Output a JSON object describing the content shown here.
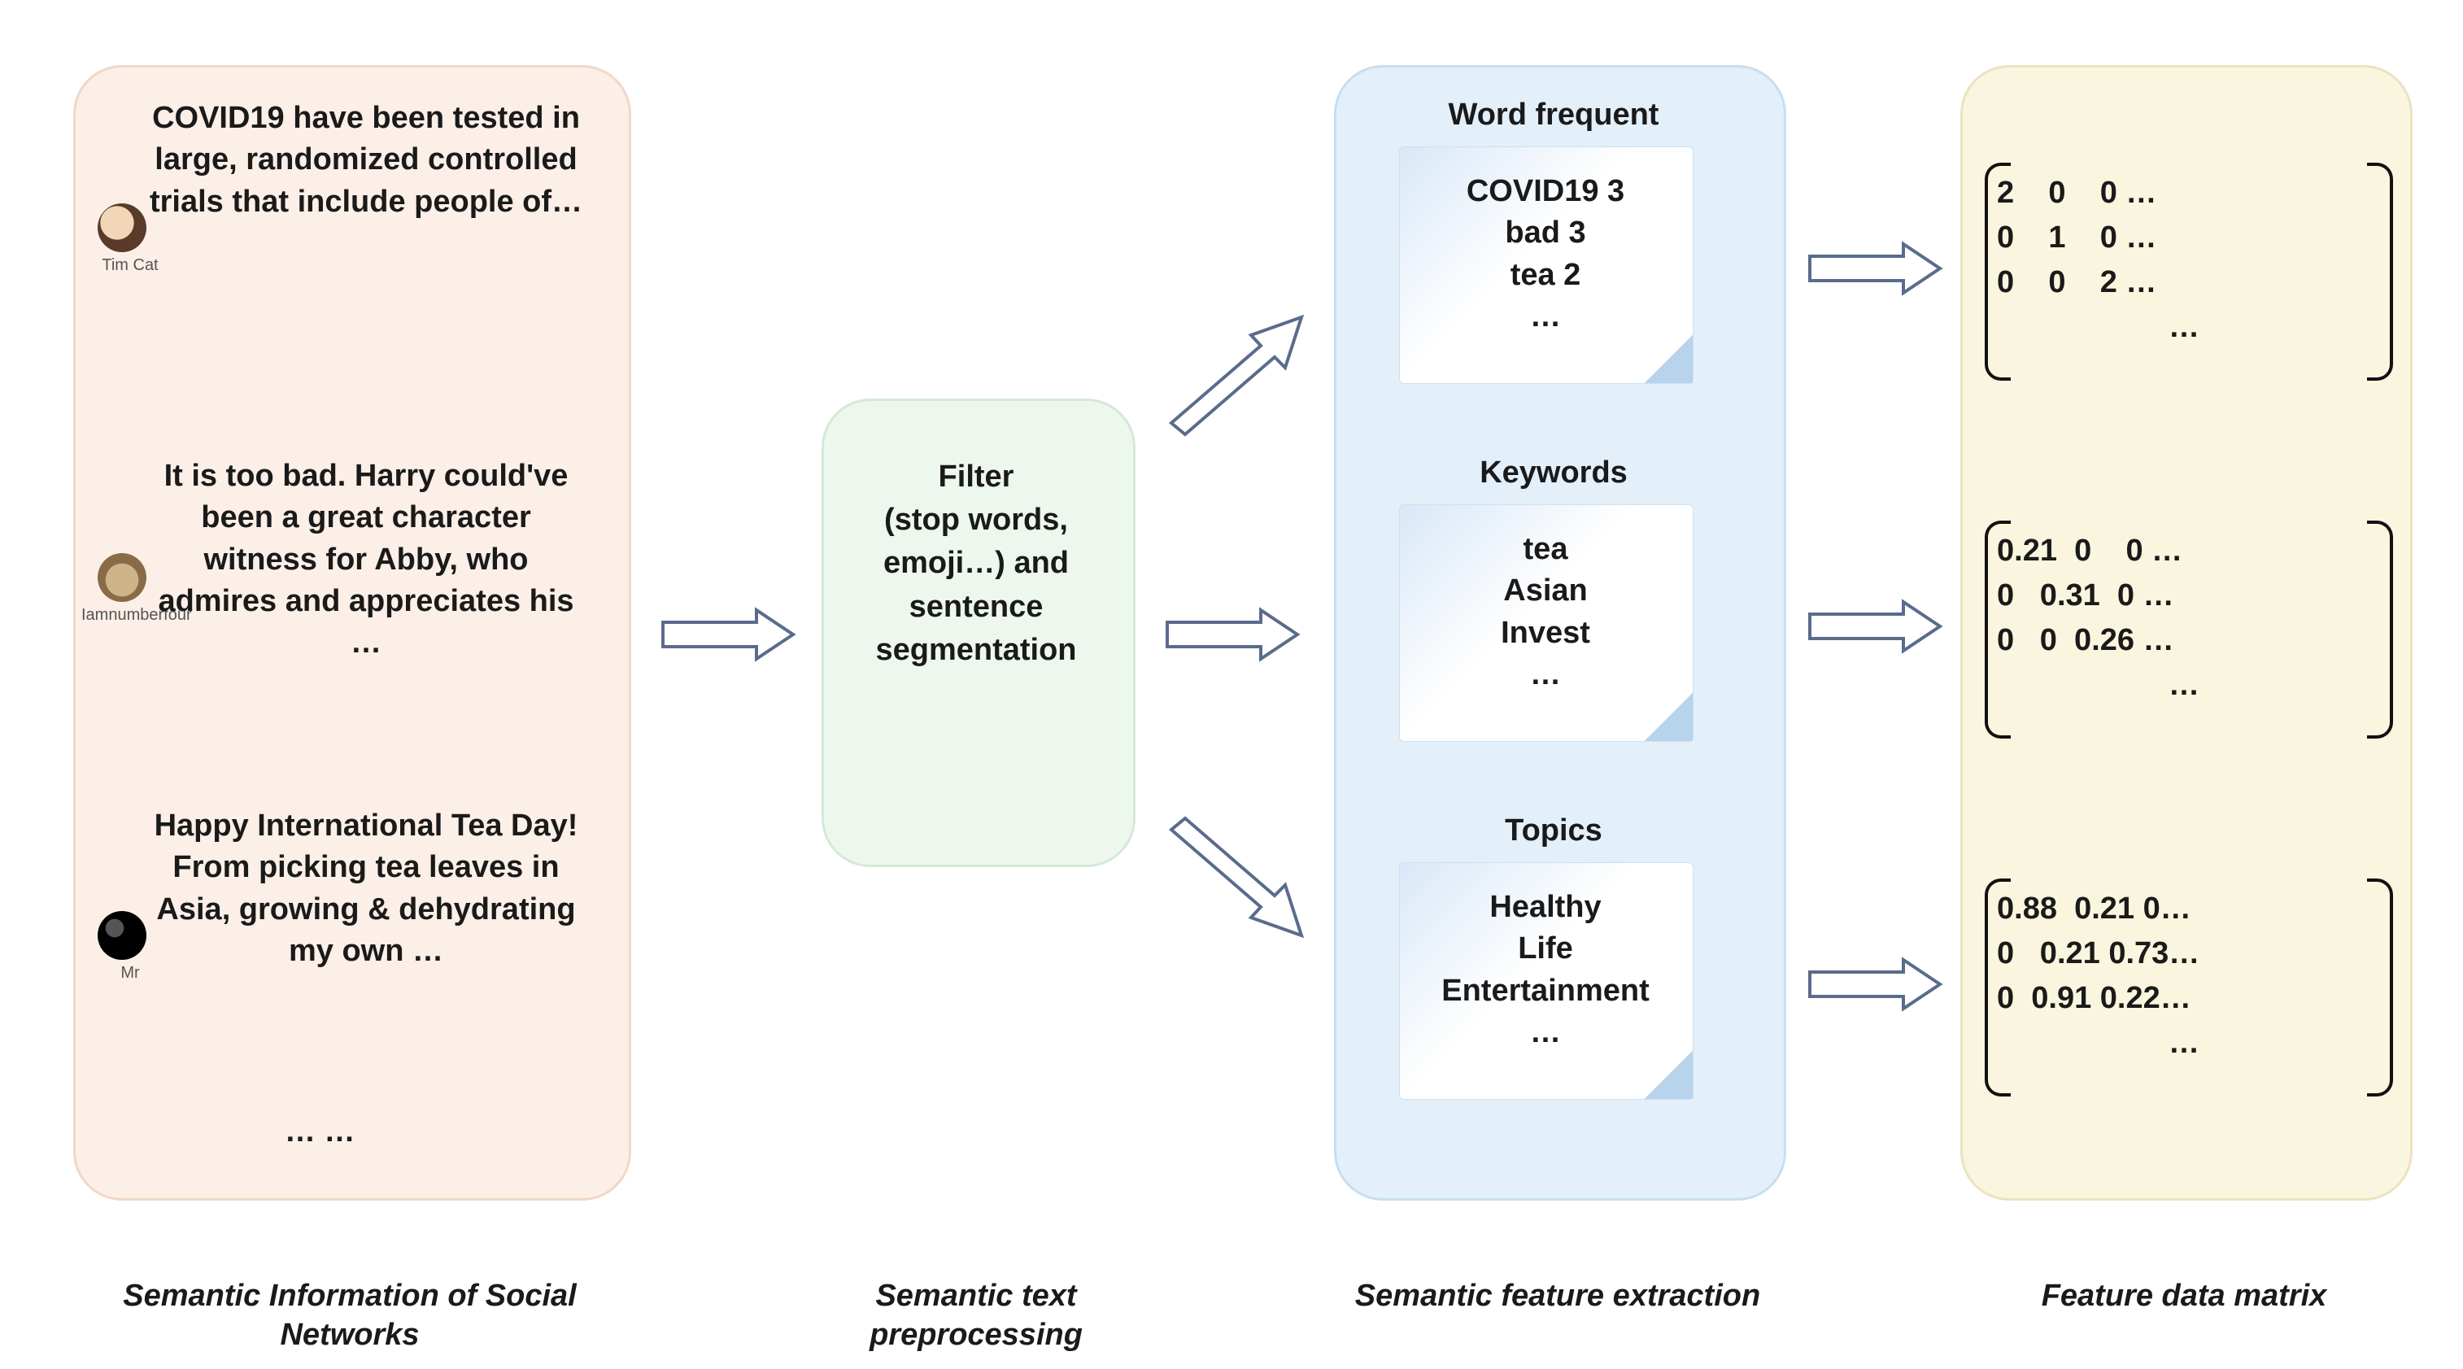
{
  "social": {
    "caption": "Semantic Information of Social Networks",
    "users": {
      "u1": "Tim Cat",
      "u2": "Iamnumberfour",
      "u3": "Mr"
    },
    "posts": {
      "p1": "COVID19 have been tested in large, randomized controlled trials that include people of…",
      "p2": "It is too bad.  Harry could've been a great character witness for Abby, who admires and appreciates his …",
      "p3": "Happy International Tea Day! From picking tea leaves in Asia, growing & dehydrating my own …"
    },
    "more": "… …"
  },
  "preprocess": {
    "caption": "Semantic text preprocessing",
    "text_l1": "Filter",
    "text_l2": "(stop words, emoji…) and sentence segmentation"
  },
  "features": {
    "caption": "Semantic feature extraction",
    "blocks": {
      "wf": {
        "title": "Word frequent",
        "l1": "COVID19  3",
        "l2": "bad 3",
        "l3": "tea 2",
        "l4": "…"
      },
      "kw": {
        "title": "Keywords",
        "l1": "tea",
        "l2": "Asian",
        "l3": "Invest",
        "l4": "…"
      },
      "tp": {
        "title": "Topics",
        "l1": "Healthy",
        "l2": "Life",
        "l3": "Entertainment",
        "l4": "…"
      }
    }
  },
  "matrix": {
    "caption": "Feature data matrix",
    "m1": {
      "r1": "2    0    0 …",
      "r2": "0    1    0 …",
      "r3": "0    0    2 …",
      "r4": "…"
    },
    "m2": {
      "r1": "0.21  0    0 …",
      "r2": "0   0.31  0 …",
      "r3": "0   0  0.26 …",
      "r4": "…"
    },
    "m3": {
      "r1": "0.88  0.21 0…",
      "r2": "0   0.21 0.73…",
      "r3": "0  0.91 0.22…",
      "r4": "…"
    }
  },
  "chart_data": {
    "type": "diagram",
    "word_frequent": {
      "COVID19": 3,
      "bad": 3,
      "tea": 2
    },
    "keywords": [
      "tea",
      "Asian",
      "Invest"
    ],
    "topics": [
      "Healthy",
      "Life",
      "Entertainment"
    ],
    "matrices": {
      "word_frequent": [
        [
          2,
          0,
          0
        ],
        [
          0,
          1,
          0
        ],
        [
          0,
          0,
          2
        ]
      ],
      "keywords": [
        [
          0.21,
          0,
          0
        ],
        [
          0,
          0.31,
          0
        ],
        [
          0,
          0,
          0.26
        ]
      ],
      "topics": [
        [
          0.88,
          0.21,
          0
        ],
        [
          0,
          0.21,
          0.73
        ],
        [
          0,
          0.91,
          0.22
        ]
      ]
    }
  }
}
